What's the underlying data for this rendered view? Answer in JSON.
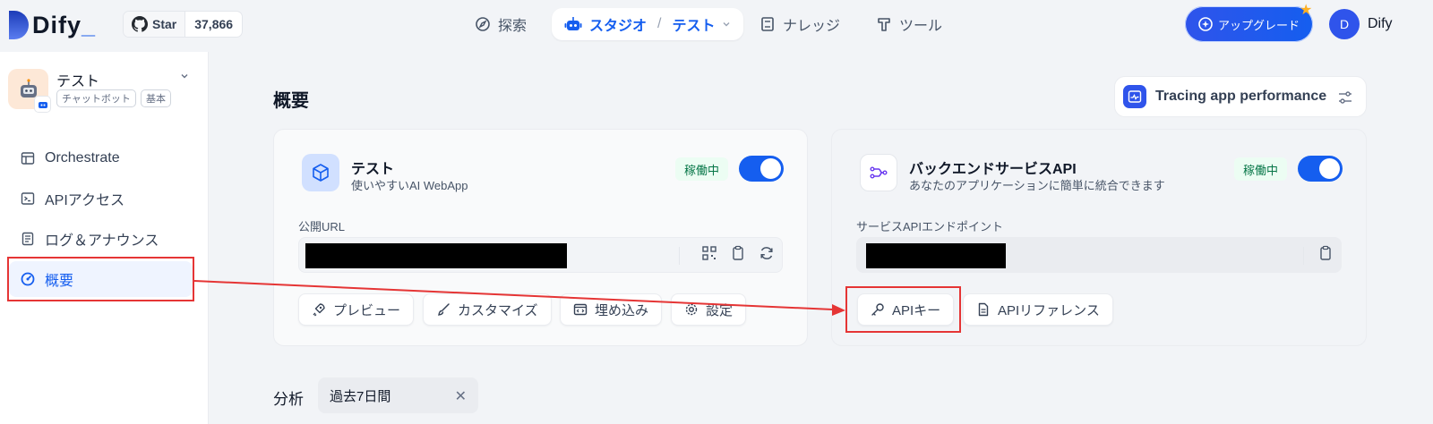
{
  "header": {
    "logo_text": "Dify",
    "github": {
      "star_label": "Star",
      "star_count": "37,866"
    },
    "nav": {
      "explore": "探索",
      "studio": "スタジオ",
      "studio_separator": "/",
      "current_app": "テスト",
      "knowledge": "ナレッジ",
      "tools": "ツール"
    },
    "upgrade_label": "アップグレード",
    "user": {
      "initial": "D",
      "name": "Dify"
    }
  },
  "sidebar": {
    "app_name": "テスト",
    "tags": [
      "チャットボット",
      "基本"
    ],
    "menu": [
      {
        "label": "Orchestrate",
        "icon": "layout-icon"
      },
      {
        "label": "APIアクセス",
        "icon": "terminal-icon"
      },
      {
        "label": "ログ＆アナウンス",
        "icon": "file-list-icon"
      },
      {
        "label": "概要",
        "icon": "dashboard-icon",
        "active": true
      }
    ]
  },
  "main": {
    "title": "概要",
    "tracing_label": "Tracing app performance",
    "webapp_card": {
      "title": "テスト",
      "subtitle": "使いやすいAI WebApp",
      "status": "稼働中",
      "enabled": true,
      "field_label": "公開URL",
      "buttons": [
        "プレビュー",
        "カスタマイズ",
        "埋め込み",
        "設定"
      ]
    },
    "api_card": {
      "title": "バックエンドサービスAPI",
      "subtitle": "あなたのアプリケーションに簡単に統合できます",
      "status": "稼働中",
      "enabled": true,
      "field_label": "サービスAPIエンドポイント",
      "buttons": [
        "APIキー",
        "APIリファレンス"
      ]
    },
    "analysis_label": "分析",
    "period_value": "過去7日間"
  },
  "colors": {
    "accent": "#155eef",
    "status_bg": "#ecfdf3",
    "status_text": "#067647",
    "annotation": "#e53535"
  }
}
